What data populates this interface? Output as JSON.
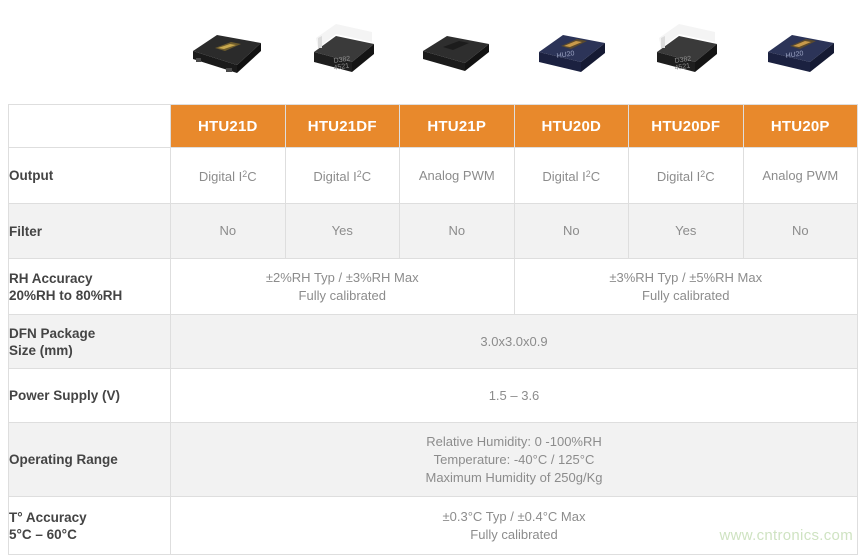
{
  "table": {
    "accent_color": "#e8892c",
    "header_text_color": "#ffffff",
    "label_text_color": "#444444",
    "value_text_color": "#8c8c8c",
    "row_alt_color": "#f2f2f2",
    "corner_label": "",
    "columns": [
      {
        "label": "HTU21D",
        "image": "black-dfn-chip-gold-pad"
      },
      {
        "label": "HTU21DF",
        "image": "black-dfn-chip-white-filter-cap"
      },
      {
        "label": "HTU21P",
        "image": "black-dfn-chip-plain"
      },
      {
        "label": "HTU20D",
        "image": "blue-dfn-chip-marked"
      },
      {
        "label": "HTU20DF",
        "image": "black-dfn-chip-white-filter-cap"
      },
      {
        "label": "HTU20P",
        "image": "blue-dfn-chip-marked"
      }
    ],
    "rows": [
      {
        "label": "Output",
        "cells": [
          {
            "text": "Digital I2C",
            "html": "Digital I<sup>2</sup>C",
            "span": 1
          },
          {
            "text": "Digital I2C",
            "html": "Digital I<sup>2</sup>C",
            "span": 1
          },
          {
            "text": "Analog PWM",
            "html": "Analog PWM",
            "span": 1
          },
          {
            "text": "Digital I2C",
            "html": "Digital I<sup>2</sup>C",
            "span": 1
          },
          {
            "text": "Digital I2C",
            "html": "Digital I<sup>2</sup>C",
            "span": 1
          },
          {
            "text": "Analog PWM",
            "html": "Analog PWM",
            "span": 1
          }
        ]
      },
      {
        "label": "Filter",
        "cells": [
          {
            "text": "No",
            "html": "No",
            "span": 1
          },
          {
            "text": "Yes",
            "html": "Yes",
            "span": 1
          },
          {
            "text": "No",
            "html": "No",
            "span": 1
          },
          {
            "text": "No",
            "html": "No",
            "span": 1
          },
          {
            "text": "Yes",
            "html": "Yes",
            "span": 1
          },
          {
            "text": "No",
            "html": "No",
            "span": 1
          }
        ]
      },
      {
        "label": "RH Accuracy\n20%RH to 80%RH",
        "cells": [
          {
            "text": "±2%RH Typ / ±3%RH Max\nFully calibrated",
            "html": "±2%RH Typ / ±3%RH Max<br>Fully calibrated",
            "span": 3
          },
          {
            "text": "±3%RH Typ / ±5%RH Max\nFully calibrated",
            "html": "±3%RH Typ / ±5%RH Max<br>Fully calibrated",
            "span": 3
          }
        ]
      },
      {
        "label": "DFN Package\nSize (mm)",
        "cells": [
          {
            "text": "3.0x3.0x0.9",
            "html": "3.0x3.0x0.9",
            "span": 6
          }
        ]
      },
      {
        "label": "Power Supply (V)",
        "cells": [
          {
            "text": "1.5 – 3.6",
            "html": "1.5 – 3.6",
            "span": 6
          }
        ]
      },
      {
        "label": "Operating Range",
        "cells": [
          {
            "text": "Relative Humidity: 0 -100%RH\nTemperature: -40°C / 125°C\nMaximum Humidity of 250g/Kg",
            "html": "Relative Humidity: 0 -100%RH<br>Temperature: -40°C / 125°C<br>Maximum Humidity of 250g/Kg",
            "span": 6
          }
        ]
      },
      {
        "label": "T° Accuracy\n5°C – 60°C",
        "cells": [
          {
            "text": "±0.3°C Typ / ±0.4°C Max\nFully calibrated",
            "html": "±0.3°C Typ / ±0.4°C Max<br>Fully calibrated",
            "span": 6
          }
        ]
      }
    ]
  },
  "watermark": {
    "text": "www.cntronics.com",
    "color": "#cfe3c2"
  }
}
